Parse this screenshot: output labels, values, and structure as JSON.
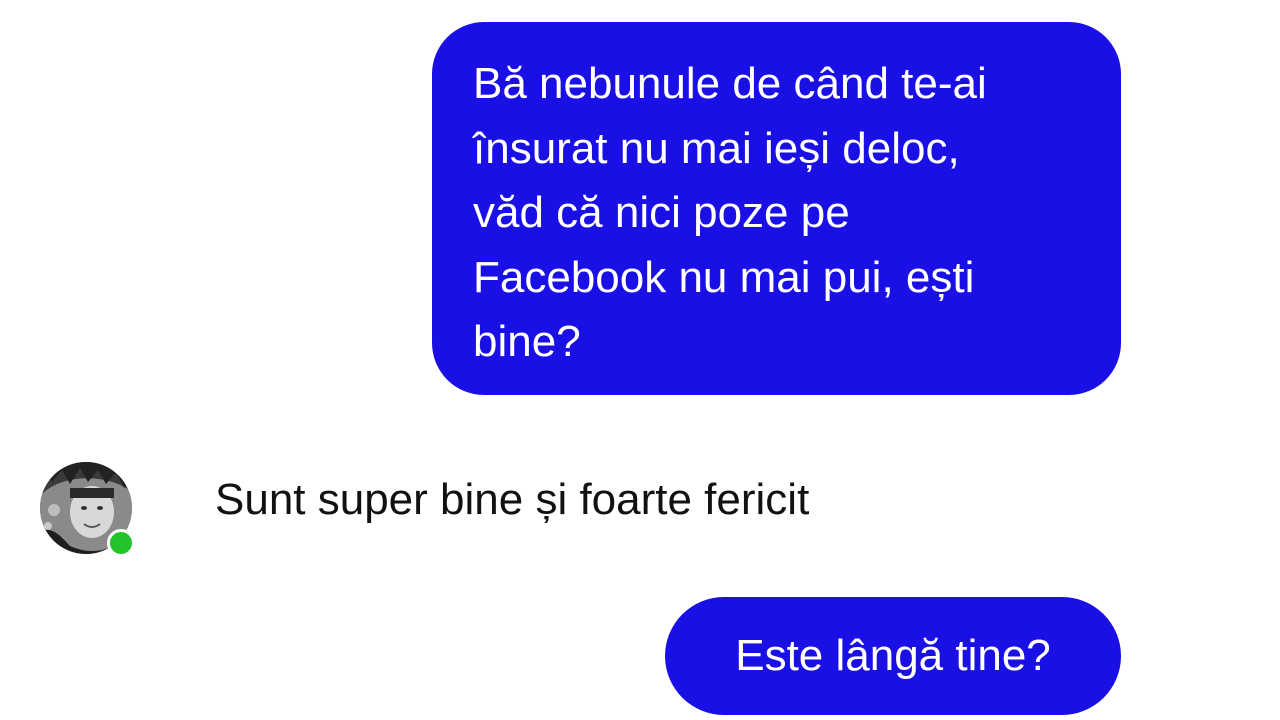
{
  "conversation": {
    "messages": [
      {
        "direction": "outgoing",
        "text": "Bă nebunule de când te-ai\nînsurat nu mai ieși deloc,\nvăd că nici poze pe\nFacebook nu mai pui, ești\nbine?"
      },
      {
        "direction": "incoming",
        "text": "Sunt super bine și foarte fericit",
        "avatar_icon": "user-avatar",
        "online": true
      },
      {
        "direction": "outgoing",
        "text": "Este lângă tine?"
      }
    ]
  },
  "colors": {
    "outgoing_bubble": "#1a10e6",
    "outgoing_text": "#ffffff",
    "incoming_text": "#111111",
    "online_indicator": "#22c22a",
    "background": "#ffffff"
  }
}
